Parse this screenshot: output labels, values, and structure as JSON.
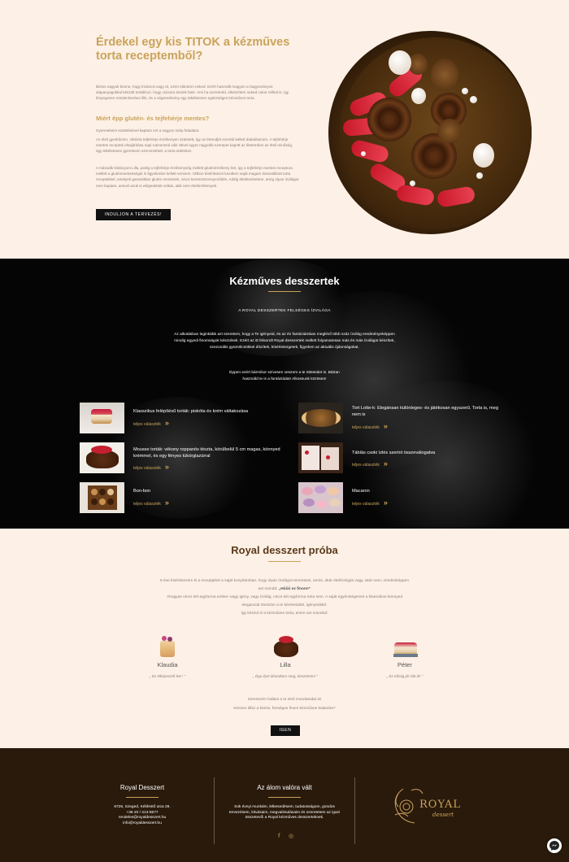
{
  "hero": {
    "title": "Érdekel egy kis TITOK a kézműves torta receptemből?",
    "paragraph1": "Biztos vagyok benne, hogy kíváncsi vagy rá, ezért elárulom neked. Ezért használt magyon a hagyományos alapanyagokkal készült tortákhoz, hogy csúcsra teszek bele. Ami ha szeretnéd, elkészítem neked cukor nélkül is, így lényegesen mindenhenhez illik, és a végeredmény egy tökéletesen egészséges kézműves torta.",
    "subtitle": "Miért épp glutén- és tejfehérje mentes?",
    "paragraph2": "Gyermekeim születésével kaptam ezt a nagyon szép feladatot.",
    "paragraph3": "Az első gyerkőcöm, Viktória tejfehérje érzékenyen született, így az étrendjét ezentúl kellett átalakítanom. A tejfehérje mentes receptek elsajátítása napi rutinommá vált. Mivel egyre nagyobb szerepet kapott az életemben az ételi minőség, úgy tökéletesen gyerekeim szerveztétett, a torta sütéshez.",
    "paragraph4": "A második kislányom Lilla, pedig a tejfehérje érzékenység mellett gluténérzékeny lett, így a tejfehérje mentes receptura mellett a gluténmentességet is figyelembe kellett vennem. Olthon kísérletezni kezdtem saját magam összeállított torta receptekkel, amelyek garantáltan glutén mentesek, nincs keresztszennyeződés. Addig töklétesítettem, amíg olyan ízvilágot nem kaptam, amivel azok is elégedettek voltak, akik nem ételérzékenyek.",
    "button": "INDULJON A TERVEZÉS!"
  },
  "desserts_section": {
    "title": "Kézműves desszertek",
    "caps": "A ROYAL DESSZERTEK FELSÉGES ÍZVILÁGA",
    "text1": "Az alkotásban leginkább azt szeretem, hogy a Te igényeid, és az én fantáziámban meglévő több száz ízvilág eredményeképpen mindig egyedi finomságok készülnek. Ezért az itt felsorolt Royal desszertek mellett folyamatosan más és más ízvilágot készítek, szezonális gyümölcsökkel díszítek, kísérletezgetek, figyelem az aktuális újdonságokat.",
    "text2": "Éppen ezért bármikor szívesen veszem a te ötleteidet is. Bátran használd te is a fantáziádat! Alkossunk közösen!",
    "more_label": "teljes választék",
    "items": [
      {
        "name": "Klasszikus felépítésű torták: piskóta és krém váltakozása"
      },
      {
        "name": "Tort Lotte-k: Elegánsan különleges- és játékosan egyszerű. Torta is, meg nem is"
      },
      {
        "name": "Mousse torták: vékony roppanós tészta, körülbelül 5 cm magas, könnyed krémmel, és egy fényes tükörglazúrral"
      },
      {
        "name": "Táblás csoki ízlés szerint összeválogatva"
      },
      {
        "name": "Bon-bon"
      },
      {
        "name": "Macaron"
      }
    ]
  },
  "proba": {
    "title": "Royal desszert próba",
    "line1": "5 éve kísérletezem ki a receptjeket a saját konyhámban, hogy olyan ízvilágot teremtsek, amire, akár ételérzégás vagy, akár nem, mindenképpen azt mondd:",
    "line1_bold": "„Hűűű ez finom!”",
    "line2": "Ahogyan nincs két egyforma ember–vagy igény, vagy ízvilág, nincs két egyforma torta sem. A saját egyéniségemet a klasszikus könnyed eleganciát ötvözöm a te kéréseiddel, igényeiddel.",
    "line3": "Így készül el a kézműves torta, amire azt mondod:",
    "people": [
      {
        "name": "Klaudia",
        "quote": "„ Ez elképesztő lett ! ”"
      },
      {
        "name": "Lilla",
        "quote": "„ Épp ilyet álmodtam meg, köszönöm! ”"
      },
      {
        "name": "Péter",
        "quote": "„ Ez túlság jól sikt lé! ”"
      }
    ],
    "closing1": "Szeretném hallani a te első mondatodat is!",
    "closing2": "Készen állsz a közös, fenséges finom kézműves kalandra?",
    "button": "IGEN"
  },
  "footer": {
    "col1_title": "Royal Desszert",
    "address": "6726, Szeged, Kékfestő utca 29.",
    "phone": "+36 20 / 413-5577",
    "email1": "rendeles@royaldesszert.hu",
    "email2": "info@royaldesszert.hu",
    "col2_title": "Az álom valóra vált",
    "slogan": "Sok évnyi munkám, lelkesedésem, tudatosságom, gondos tervezésem, kitvásaim, megvalósulásaim és szeretetem az igazi összetevői a Royal kézműves desszerteknek.",
    "logo_text": "ROYAL",
    "logo_sub": "dessert",
    "facebook_icon": "f",
    "instagram_icon": "◎"
  },
  "colors": {
    "accent_gold": "#c9a35a",
    "hero_bg": "#fdf0e6",
    "dark_bg": "#050505",
    "footer_bg": "#2a1a0c"
  }
}
